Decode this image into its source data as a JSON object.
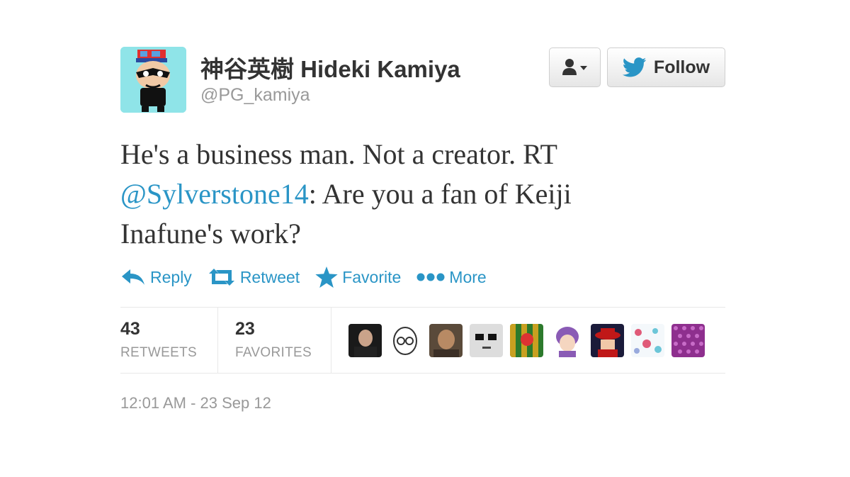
{
  "user": {
    "full_name": "神谷英樹 Hideki Kamiya",
    "handle": "@PG_kamiya",
    "follow_label": "Follow"
  },
  "tweet": {
    "text_before": "He's a business man. Not a creator. RT ",
    "mention": "@Sylverstone14",
    "text_after": ": Are you a fan of Keiji Inafune's work?",
    "timestamp": "12:01 AM - 23 Sep 12"
  },
  "actions": {
    "reply": "Reply",
    "retweet": "Retweet",
    "favorite": "Favorite",
    "more": "More"
  },
  "stats": {
    "retweets_count": "43",
    "retweets_label": "RETWEETS",
    "favorites_count": "23",
    "favorites_label": "FAVORITES"
  },
  "icons": [
    "user-icon",
    "twitter-bird-icon",
    "reply-icon",
    "retweet-icon",
    "star-icon",
    "ellipsis-icon",
    "caret-down-icon"
  ],
  "colors": {
    "link": "#2a95c6",
    "text": "#333333",
    "muted": "#999999",
    "twitter_bird": "#2a95c6"
  }
}
